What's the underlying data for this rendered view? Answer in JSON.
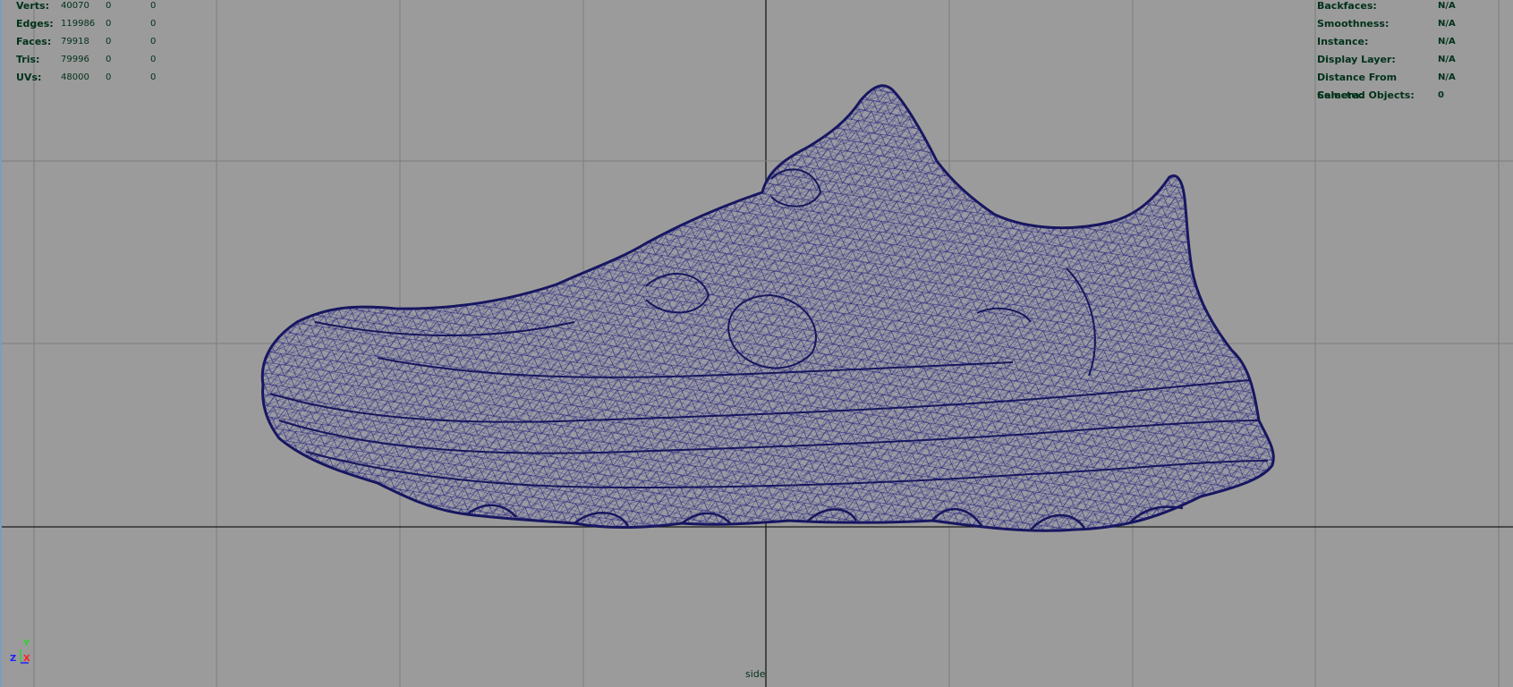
{
  "viewport": {
    "camera": "side",
    "background_color": "#9b9b9b",
    "grid_color": "#7e7e7e",
    "axis_line_color": "#1a1a1a",
    "wireframe_color": "#1d1b7a"
  },
  "heads_up_display": {
    "poly_count": [
      {
        "label": "Verts:",
        "value": "40070",
        "selected": "0",
        "uv": "0"
      },
      {
        "label": "Edges:",
        "value": "119986",
        "selected": "0",
        "uv": "0"
      },
      {
        "label": "Faces:",
        "value": "79918",
        "selected": "0",
        "uv": "0"
      },
      {
        "label": "Tris:",
        "value": "79996",
        "selected": "0",
        "uv": "0"
      },
      {
        "label": "UVs:",
        "value": "48000",
        "selected": "0",
        "uv": "0"
      }
    ],
    "object_details": [
      {
        "label": "Backfaces:",
        "value": "N/A"
      },
      {
        "label": "Smoothness:",
        "value": "N/A"
      },
      {
        "label": "Instance:",
        "value": "N/A"
      },
      {
        "label": "Display Layer:",
        "value": "N/A"
      },
      {
        "label": "Distance From Camera:",
        "value": "N/A"
      },
      {
        "label": "Selected Objects:",
        "value": "0"
      }
    ]
  },
  "axis_gizmo": {
    "y_label": "Y",
    "z_label": "Z",
    "x_label": "X",
    "y_color": "#2fd02f",
    "z_color": "#2020ff",
    "x_color": "#ff2020"
  },
  "model": {
    "icon": "sneaker-wireframe-mesh"
  }
}
